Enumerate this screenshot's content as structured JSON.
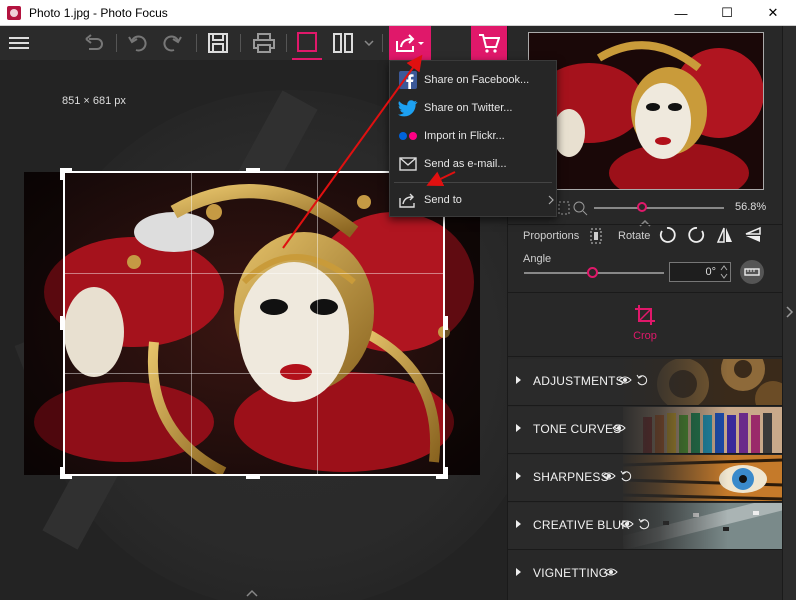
{
  "window": {
    "title": "Photo 1.jpg - Photo Focus",
    "minimize": "—",
    "maximize": "☐",
    "close": "✕"
  },
  "toolbar": {
    "menu_icon": "hamburger-menu-icon",
    "undo_all_icon": "undo-all-icon",
    "undo_icon": "undo-icon",
    "redo_icon": "redo-icon",
    "save_icon": "save-icon",
    "print_icon": "print-icon",
    "single_view_icon": "single-view-icon",
    "compare_view_icon": "compare-view-icon",
    "share_icon": "share-icon",
    "cart_icon": "cart-icon",
    "accent_color": "#e0186a"
  },
  "canvas": {
    "size_label": "851 × 681 px"
  },
  "share_menu": {
    "items": [
      {
        "label": "Share on Facebook...",
        "icon": "facebook-icon"
      },
      {
        "label": "Share on Twitter...",
        "icon": "twitter-icon"
      },
      {
        "label": "Import in Flickr...",
        "icon": "flickr-icon"
      },
      {
        "label": "Send as e-mail...",
        "icon": "mail-icon"
      },
      {
        "label": "Send to",
        "icon": "share-icon"
      }
    ]
  },
  "navigator": {
    "zoom_value": "56.8%",
    "zoom_fraction": 0.568
  },
  "crop_panel": {
    "proportions_label": "Proportions",
    "rotate_label": "Rotate",
    "angle_label": "Angle",
    "angle_value": "0°",
    "crop_label": "Crop"
  },
  "accordion": [
    {
      "label": "ADJUSTMENTS",
      "icon": "gears-image"
    },
    {
      "label": "TONE CURVES",
      "icon": "pencils-image"
    },
    {
      "label": "SHARPNESS",
      "icon": "tiger-eye-image"
    },
    {
      "label": "CREATIVE BLUR",
      "icon": "city-street-image"
    },
    {
      "label": "VIGNETTING",
      "icon": ""
    }
  ]
}
